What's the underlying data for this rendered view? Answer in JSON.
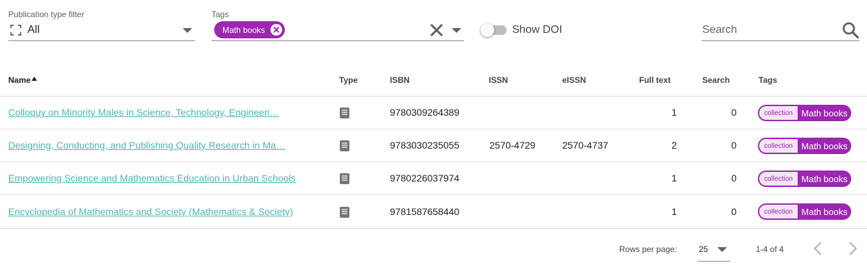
{
  "filters": {
    "publication_type": {
      "label": "Publication type filter",
      "value": "All",
      "icon": "fullscreen-icon"
    },
    "tags": {
      "label": "Tags",
      "chips": [
        "Math books"
      ]
    },
    "show_doi": {
      "label": "Show DOI",
      "checked": false
    },
    "search": {
      "placeholder": "Search"
    }
  },
  "table": {
    "columns": {
      "name": "Name",
      "type": "Type",
      "isbn": "ISBN",
      "issn": "ISSN",
      "eissn": "eISSN",
      "full_text": "Full text",
      "search": "Search",
      "tags": "Tags"
    },
    "rows": [
      {
        "name": "Colloquy on Minority Males in Science, Technology, Engineeri…",
        "type_icon": "book-icon",
        "isbn": "9780309264389",
        "issn": "",
        "eissn": "",
        "full_text": "1",
        "search": "0",
        "tag_kind": "collection",
        "tag_name": "Math books"
      },
      {
        "name": "Designing, Conducting, and Publishing Quality Research in Ma…",
        "type_icon": "book-icon",
        "isbn": "9783030235055",
        "issn": "2570-4729",
        "eissn": "2570-4737",
        "full_text": "2",
        "search": "0",
        "tag_kind": "collection",
        "tag_name": "Math books"
      },
      {
        "name": "Empowering Science and Mathematics Education in Urban Schools",
        "type_icon": "book-icon",
        "isbn": "9780226037974",
        "issn": "",
        "eissn": "",
        "full_text": "1",
        "search": "0",
        "tag_kind": "collection",
        "tag_name": "Math books"
      },
      {
        "name": "Encyclopedia of Mathematics and Society (Mathematics & Society)",
        "type_icon": "book-icon",
        "isbn": "9781587658440",
        "issn": "",
        "eissn": "",
        "full_text": "1",
        "search": "0",
        "tag_kind": "collection",
        "tag_name": "Math books"
      }
    ]
  },
  "pagination": {
    "rows_per_page_label": "Rows per page:",
    "rows_per_page": "25",
    "range": "1-4 of 4"
  },
  "colors": {
    "accent": "#9c27b0",
    "link": "#4db6ac"
  }
}
